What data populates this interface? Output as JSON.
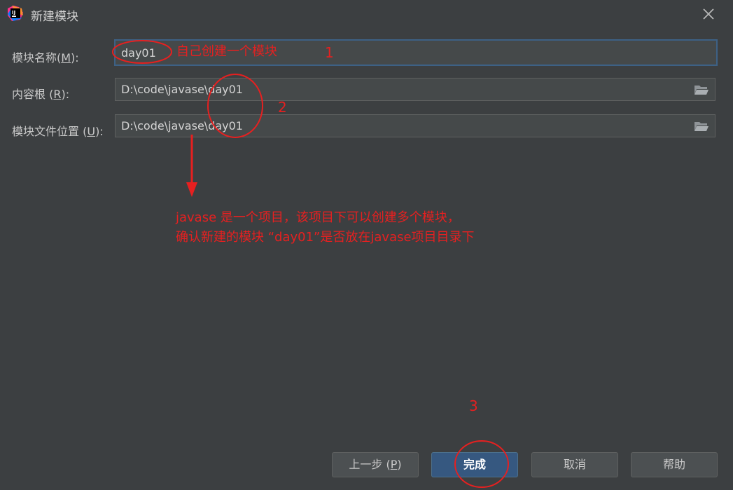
{
  "window": {
    "title": "新建模块",
    "app_icon": "intellij-idea-icon",
    "close_icon": "close-icon"
  },
  "form": {
    "module_name": {
      "label_prefix": "模块名称(",
      "mnemonic": "M",
      "label_suffix": "):",
      "value": "day01"
    },
    "content_root": {
      "label_prefix": "内容根 (",
      "mnemonic": "R",
      "label_suffix": "):",
      "value": "D:\\code\\javase\\day01"
    },
    "module_file_location": {
      "label_prefix": "模块文件位置 (",
      "mnemonic": "U",
      "label_suffix": "):",
      "value": "D:\\code\\javase\\day01"
    },
    "browse_icon": "folder-icon"
  },
  "buttons": {
    "previous": {
      "prefix": "上一步 (",
      "mnemonic": "P",
      "suffix": ")"
    },
    "finish": "完成",
    "cancel": "取消",
    "help": "帮助"
  },
  "annotations": {
    "step1_note": "自己创建一个模块",
    "step1_number": "1",
    "step2_number": "2",
    "step3_number": "3",
    "explanation_line1": "javase 是一个项目，该项目下可以创建多个模块，",
    "explanation_line2": "确认新建的模块 “day01”是否放在javase项目目录下",
    "color": "#e62020"
  }
}
